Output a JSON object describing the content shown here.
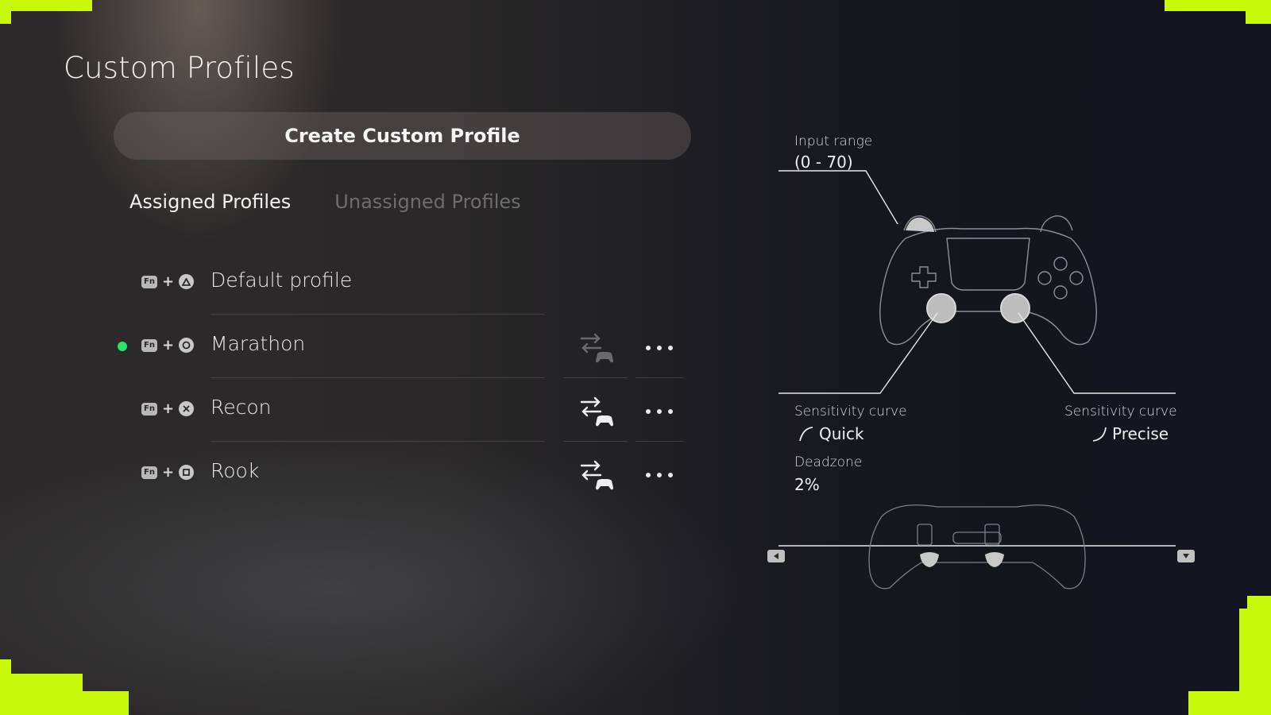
{
  "page": {
    "title": "Custom Profiles"
  },
  "create_button": {
    "label": "Create Custom Profile"
  },
  "tabs": [
    {
      "label": "Assigned Profiles",
      "active": true
    },
    {
      "label": "Unassigned Profiles",
      "active": false
    }
  ],
  "profiles": [
    {
      "name": "Default profile",
      "fn": "Fn",
      "plus": "+",
      "button_icon": "triangle-icon",
      "active": false
    },
    {
      "name": "Marathon",
      "fn": "Fn",
      "plus": "+",
      "button_icon": "circle-icon",
      "active": true
    },
    {
      "name": "Recon",
      "fn": "Fn",
      "plus": "+",
      "button_icon": "cross-icon",
      "active": false
    },
    {
      "name": "Rook",
      "fn": "Fn",
      "plus": "+",
      "button_icon": "square-icon",
      "active": false
    }
  ],
  "details": {
    "input_range_label": "Input range",
    "input_range_value": "(0 - 70)",
    "left_curve_label": "Sensitivity curve",
    "left_curve_value": "Quick",
    "right_curve_label": "Sensitivity curve",
    "right_curve_value": "Precise",
    "deadzone_label": "Deadzone",
    "deadzone_value": "2%"
  },
  "colors": {
    "accent": "#c8f90a",
    "active_dot": "#2ee06c"
  },
  "icons": {
    "more": "more-options-icon",
    "swap": "swap-controller-icon",
    "nav_left": "arrow-left-icon",
    "nav_down": "arrow-down-icon"
  }
}
